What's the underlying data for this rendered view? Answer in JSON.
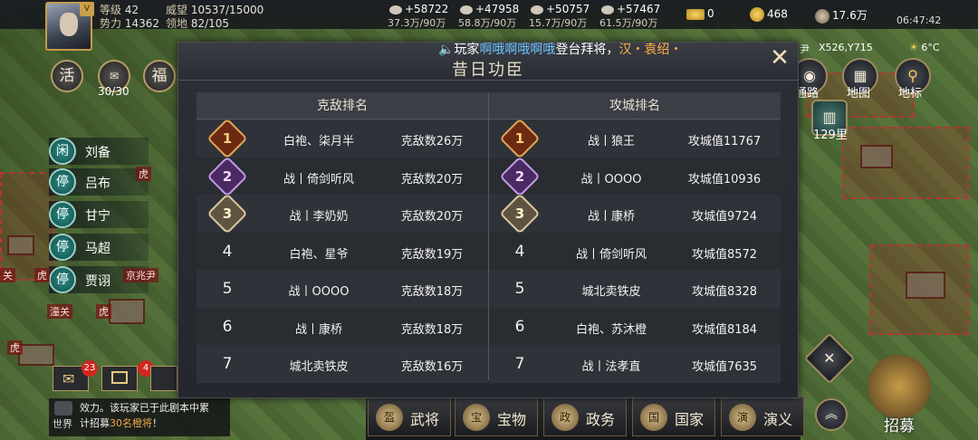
{
  "player": {
    "level_label": "等级",
    "level": "42",
    "power_label": "势力",
    "power": "14362",
    "prestige_label": "威望",
    "prestige": "10537/15000",
    "territory_label": "领地",
    "territory": "82/105"
  },
  "resources": [
    {
      "icon": "wood-icon",
      "gain": "+58722",
      "amount": "37.3万/90万"
    },
    {
      "icon": "iron-icon",
      "gain": "+47958",
      "amount": "58.8万/90万"
    },
    {
      "icon": "stone-icon",
      "gain": "+50757",
      "amount": "15.7万/90万"
    },
    {
      "icon": "grain-icon",
      "gain": "+57467",
      "amount": "61.5万/90万"
    }
  ],
  "currency": {
    "ingot": "0",
    "gold": "468",
    "copper": "17.6万"
  },
  "clock": "06:47:42",
  "left_buttons": {
    "activity": "活",
    "stamina": "30/30",
    "fortune": "福"
  },
  "generals": [
    {
      "status": "闲",
      "name": "刘备"
    },
    {
      "status": "停",
      "name": "吕布"
    },
    {
      "status": "停",
      "name": "甘宁"
    },
    {
      "status": "停",
      "name": "马超"
    },
    {
      "status": "停",
      "name": "贾诩"
    }
  ],
  "map_tags": [
    "关",
    "虎",
    "京兆尹",
    "潼关",
    "虎",
    "虎",
    "虎"
  ],
  "modal": {
    "title": "昔日功臣",
    "close": "✕",
    "broadcast": {
      "pre": "玩家",
      "player": "啊哦啊哦啊哦",
      "mid": "登台拜将，",
      "faction": "汉・袁绍・"
    },
    "left_header": "克敌排名",
    "right_header": "攻城排名",
    "kill_ranking": [
      {
        "rank": "1",
        "name": "白袍、柒月半",
        "value": "克敌数26万"
      },
      {
        "rank": "2",
        "name": "战丨倚剑听风",
        "value": "克敌数20万"
      },
      {
        "rank": "3",
        "name": "战丨李奶奶",
        "value": "克敌数20万"
      },
      {
        "rank": "4",
        "name": "白袍、星爷",
        "value": "克敌数19万"
      },
      {
        "rank": "5",
        "name": "战丨OOOO",
        "value": "克敌数18万"
      },
      {
        "rank": "6",
        "name": "战丨康桥",
        "value": "克敌数18万"
      },
      {
        "rank": "7",
        "name": "城北卖铁皮",
        "value": "克敌数16万"
      }
    ],
    "siege_ranking": [
      {
        "rank": "1",
        "name": "战丨狼王",
        "value": "攻城值11767"
      },
      {
        "rank": "2",
        "name": "战丨OOOO",
        "value": "攻城值10936"
      },
      {
        "rank": "3",
        "name": "战丨康桥",
        "value": "攻城值9724"
      },
      {
        "rank": "4",
        "name": "战丨倚剑听风",
        "value": "攻城值8572"
      },
      {
        "rank": "5",
        "name": "城北卖铁皮",
        "value": "攻城值8328"
      },
      {
        "rank": "6",
        "name": "白袍、苏沐橙",
        "value": "攻城值8184"
      },
      {
        "rank": "7",
        "name": "战丨法孝直",
        "value": "攻城值7635"
      }
    ]
  },
  "right_panel": {
    "coords": "X526,Y715",
    "weather": "6°C",
    "region_suffix": "尹",
    "route": "通路",
    "map": "地图",
    "landmark": "地标",
    "distance": "129里"
  },
  "bottom_nav": [
    "武将",
    "宝物",
    "政务",
    "国家",
    "演义"
  ],
  "recruit": "招募",
  "chat": {
    "line1": "效力。该玩家已于此剧本中累",
    "line2_pre": "计招募",
    "line2_hl": "30名橙将",
    "line2_post": "！",
    "channel": "世界"
  },
  "mail_badges": [
    "23",
    "4"
  ]
}
